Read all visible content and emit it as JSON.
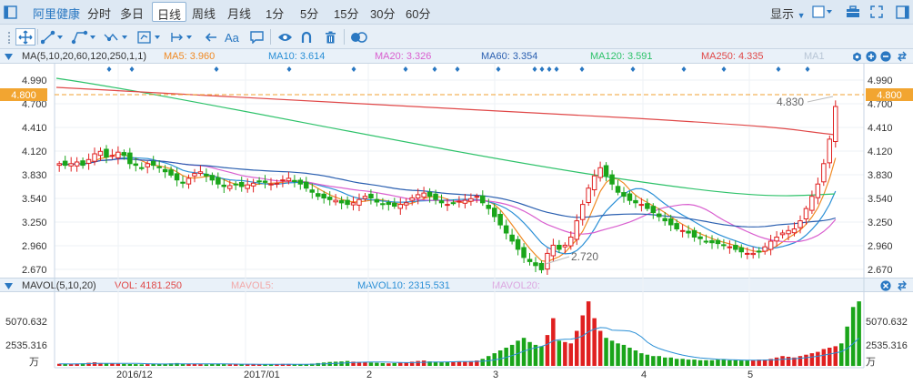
{
  "toolbar": {
    "stock_name": "阿里健康",
    "periods": [
      "分时",
      "多日",
      "日线",
      "周线",
      "月线",
      "1分",
      "5分",
      "15分",
      "30分",
      "60分"
    ],
    "active_period": "日线",
    "display_label": "显示"
  },
  "ma_legend": {
    "header": "MA(5,10,20,60,120,250,1,1)",
    "items": [
      {
        "label": "MA5: 3.960",
        "color": "#f08a24"
      },
      {
        "label": "MA10: 3.614",
        "color": "#2a8fd6"
      },
      {
        "label": "MA20: 3.326",
        "color": "#d95fcf"
      },
      {
        "label": "MA60: 3.354",
        "color": "#2a5fb0"
      },
      {
        "label": "MA120: 3.591",
        "color": "#2ec26a"
      },
      {
        "label": "MA250: 4.335",
        "color": "#e04848"
      },
      {
        "label": "MA1",
        "color": "#b8c6d6"
      }
    ]
  },
  "price_axis": {
    "ticks": [
      "4.990",
      "4.700",
      "4.410",
      "4.120",
      "3.830",
      "3.540",
      "3.250",
      "2.960",
      "2.670"
    ],
    "current_price": "4.800"
  },
  "annotations": {
    "high": "4.830",
    "low": "2.720"
  },
  "volume_legend": {
    "header": "MAVOL(5,10,20)",
    "items": [
      {
        "label": "VOL: 4181.250",
        "color": "#e04848"
      },
      {
        "label": "MAVOL5:",
        "color": "#f2a8a8"
      },
      {
        "label": "MAVOL10: 2315.531",
        "color": "#2a8fd6"
      },
      {
        "label": "MAVOL20:",
        "color": "#dca6e0"
      }
    ]
  },
  "volume_axis": {
    "ticks": [
      "5070.632",
      "2535.316"
    ],
    "unit": "万"
  },
  "dates": [
    "2016/12",
    "2017/01",
    "2",
    "3",
    "4",
    "5"
  ],
  "colors": {
    "up": "#e02020",
    "down": "#1aa51a",
    "accent": "#2a78c2"
  },
  "chart_data": {
    "type": "candlestick",
    "x_labels": [
      "2016/12",
      "2017/01",
      "2",
      "3",
      "4",
      "5"
    ],
    "y_ticks": [
      4.99,
      4.7,
      4.41,
      4.12,
      3.83,
      3.54,
      3.25,
      2.96,
      2.67
    ],
    "ylim": [
      2.62,
      5.06
    ],
    "current_price": 4.8,
    "annotated_high": 4.83,
    "annotated_low": 2.72,
    "price_path": [
      4.1,
      4.08,
      4.1,
      4.12,
      4.08,
      4.15,
      4.22,
      4.25,
      4.18,
      4.2,
      4.24,
      4.2,
      4.1,
      4.08,
      4.05,
      4.1,
      4.08,
      4.05,
      4.0,
      3.96,
      3.9,
      3.86,
      3.92,
      3.98,
      4.0,
      3.95,
      3.9,
      3.85,
      3.82,
      3.83,
      3.85,
      3.82,
      3.84,
      3.86,
      3.88,
      3.87,
      3.85,
      3.86,
      3.9,
      3.92,
      3.88,
      3.85,
      3.8,
      3.75,
      3.7,
      3.68,
      3.66,
      3.65,
      3.62,
      3.6,
      3.62,
      3.66,
      3.7,
      3.68,
      3.63,
      3.6,
      3.6,
      3.58,
      3.6,
      3.62,
      3.68,
      3.72,
      3.74,
      3.7,
      3.66,
      3.62,
      3.6,
      3.62,
      3.64,
      3.65,
      3.67,
      3.7,
      3.62,
      3.55,
      3.45,
      3.35,
      3.25,
      3.15,
      3.05,
      2.95,
      2.9,
      2.85,
      2.8,
      3.0,
      3.1,
      3.05,
      3.1,
      3.2,
      3.4,
      3.6,
      3.8,
      3.95,
      4.05,
      3.95,
      3.85,
      3.75,
      3.7,
      3.65,
      3.62,
      3.6,
      3.55,
      3.5,
      3.45,
      3.4,
      3.35,
      3.3,
      3.28,
      3.25,
      3.2,
      3.18,
      3.15,
      3.13,
      3.12,
      3.1,
      3.08,
      3.05,
      3.02,
      3.0,
      3.0,
      3.02,
      3.08,
      3.15,
      3.2,
      3.25,
      3.28,
      3.3,
      3.4,
      3.55,
      3.7,
      3.85,
      4.1,
      4.4,
      4.8
    ],
    "volume_path": [
      150,
      140,
      120,
      160,
      180,
      220,
      260,
      200,
      180,
      160,
      150,
      140,
      130,
      120,
      110,
      120,
      130,
      140,
      160,
      180,
      200,
      150,
      140,
      130,
      120,
      110,
      130,
      140,
      120,
      110,
      120,
      130,
      120,
      110,
      100,
      110,
      120,
      130,
      140,
      120,
      110,
      100,
      120,
      160,
      200,
      240,
      280,
      300,
      320,
      350,
      300,
      280,
      260,
      240,
      220,
      200,
      180,
      200,
      220,
      260,
      300,
      350,
      380,
      320,
      300,
      280,
      260,
      280,
      300,
      320,
      340,
      380,
      500,
      700,
      900,
      1100,
      1300,
      1500,
      1800,
      2000,
      1700,
      1500,
      1400,
      2200,
      3400,
      1800,
      1700,
      1600,
      2500,
      3600,
      4600,
      3400,
      2500,
      2000,
      1800,
      1600,
      1500,
      1300,
      1100,
      900,
      800,
      700,
      700,
      600,
      600,
      500,
      500,
      450,
      450,
      400,
      400,
      400,
      450,
      450,
      400,
      400,
      380,
      380,
      400,
      450,
      450,
      500,
      600,
      700,
      650,
      600,
      700,
      800,
      900,
      1000,
      1200,
      1300,
      1400,
      1600,
      2800,
      4200,
      4600
    ],
    "volume_ticks": [
      5070.632,
      2535.316
    ],
    "volume_unit": "万"
  }
}
